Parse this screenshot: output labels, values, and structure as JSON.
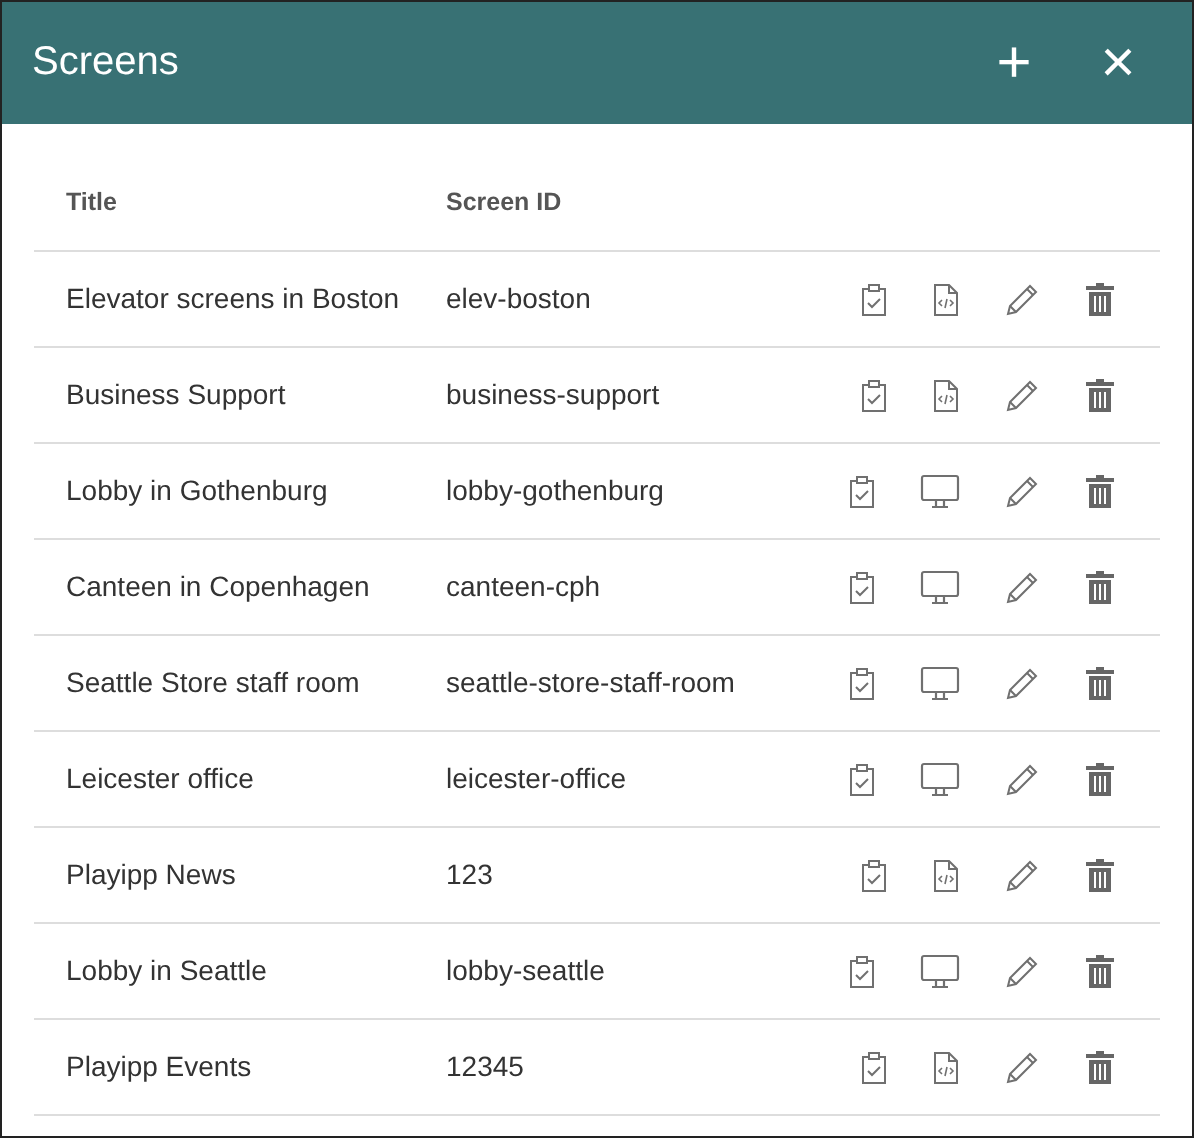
{
  "window": {
    "title": "Screens",
    "add": "+",
    "close": "×"
  },
  "table": {
    "columns": [
      "Title",
      "Screen ID"
    ],
    "rows": [
      {
        "title": "Elevator screens in Boston",
        "screen_id": "elev-boston",
        "kind": "file"
      },
      {
        "title": "Business Support",
        "screen_id": "business-support",
        "kind": "file"
      },
      {
        "title": "Lobby in Gothenburg",
        "screen_id": "lobby-gothenburg",
        "kind": "monitor"
      },
      {
        "title": "Canteen in Copenhagen",
        "screen_id": "canteen-cph",
        "kind": "monitor"
      },
      {
        "title": "Seattle Store staff room",
        "screen_id": "seattle-store-staff-room",
        "kind": "monitor"
      },
      {
        "title": "Leicester office",
        "screen_id": "leicester-office",
        "kind": "monitor"
      },
      {
        "title": "Playipp News",
        "screen_id": "123",
        "kind": "file"
      },
      {
        "title": "Lobby in Seattle",
        "screen_id": "lobby-seattle",
        "kind": "monitor"
      },
      {
        "title": "Playipp Events",
        "screen_id": "12345",
        "kind": "file"
      }
    ]
  }
}
